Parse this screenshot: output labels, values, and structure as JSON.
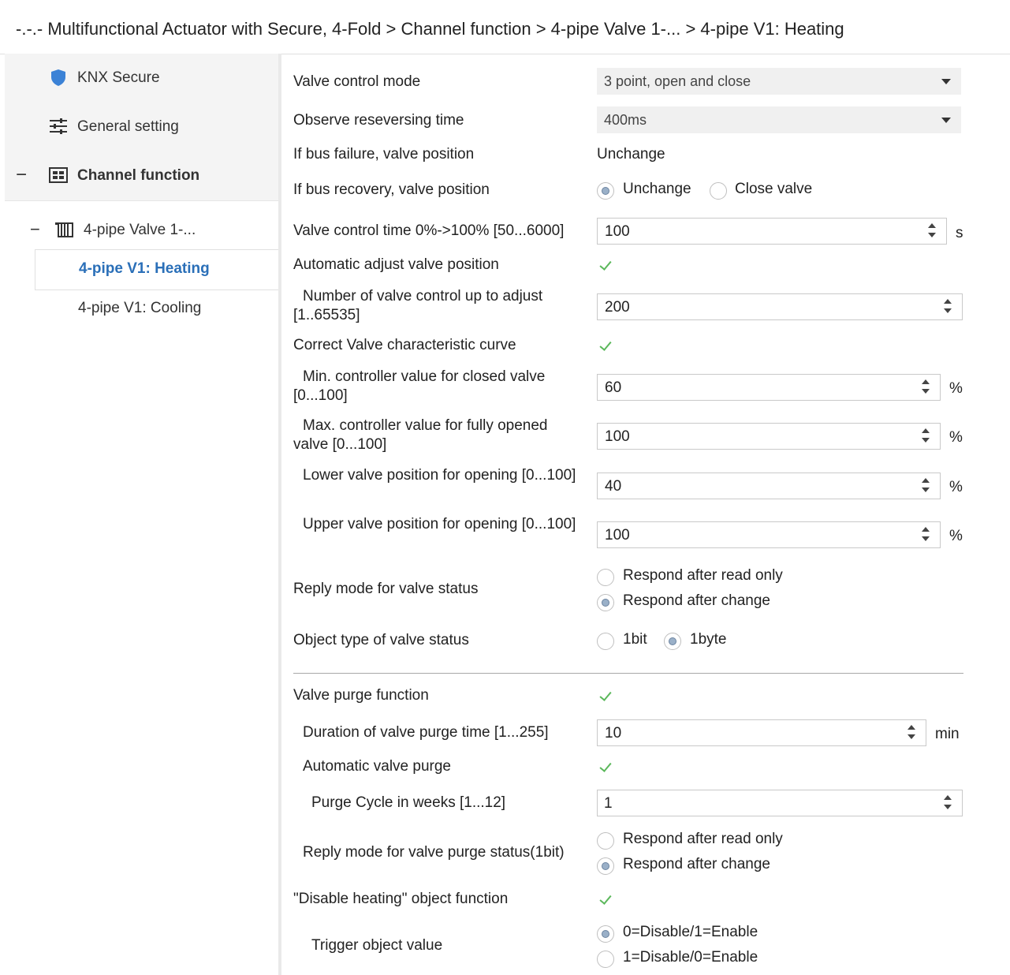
{
  "breadcrumb": "-.-.- Multifunctional Actuator with Secure, 4-Fold > Channel function > 4-pipe Valve 1-... > 4-pipe V1: Heating",
  "sidebar": {
    "items": [
      {
        "label": "KNX Secure",
        "icon": "shield-icon"
      },
      {
        "label": "General setting",
        "icon": "sliders-icon"
      },
      {
        "label": "Channel function",
        "icon": "grid-icon",
        "toggle": "−"
      },
      {
        "label": "4-pipe Valve 1-...",
        "icon": "radiator-icon",
        "toggle": "−"
      },
      {
        "label": "4-pipe V1: Heating",
        "active": true
      },
      {
        "label": "4-pipe V1: Cooling"
      }
    ]
  },
  "form": {
    "valve_control_mode": {
      "label": "Valve control mode",
      "value": "3 point, open and close"
    },
    "observe_time": {
      "label": "Observe reseversing time",
      "value": "400ms"
    },
    "bus_failure": {
      "label": "If bus failure, valve position",
      "value": "Unchange"
    },
    "bus_recovery": {
      "label": "If bus recovery, valve position",
      "options": [
        "Unchange",
        "Close valve"
      ],
      "selected": "Unchange"
    },
    "control_time": {
      "label": "Valve control time 0%->100% [50...6000]",
      "value": "100",
      "unit": "s"
    },
    "auto_adjust": {
      "label": "Automatic adjust valve position",
      "checked": true
    },
    "adjust_count": {
      "label": "Number of valve control up to adjust [1..65535]",
      "value": "200"
    },
    "correct_curve": {
      "label": "Correct Valve characteristic curve",
      "checked": true
    },
    "min_closed": {
      "label": "Min. controller value for closed valve [0...100]",
      "value": "60",
      "unit": "%"
    },
    "max_open": {
      "label": "Max. controller value for fully opened valve [0...100]",
      "value": "100",
      "unit": "%"
    },
    "lower_pos": {
      "label": "Lower valve position for opening [0...100]",
      "value": "40",
      "unit": "%"
    },
    "upper_pos": {
      "label": "Upper valve position for opening [0...100]",
      "value": "100",
      "unit": "%"
    },
    "reply_mode": {
      "label": "Reply mode for valve status",
      "options": [
        "Respond after read only",
        "Respond after change"
      ],
      "selected": "Respond after change"
    },
    "object_type": {
      "label": "Object type of valve status",
      "options": [
        "1bit",
        "1byte"
      ],
      "selected": "1byte"
    },
    "purge_func": {
      "label": "Valve purge function",
      "checked": true
    },
    "purge_duration": {
      "label": "Duration of valve purge time [1...255]",
      "value": "10",
      "unit": "min"
    },
    "auto_purge": {
      "label": "Automatic valve purge",
      "checked": true
    },
    "purge_cycle": {
      "label": "Purge Cycle in weeks [1...12]",
      "value": "1"
    },
    "purge_reply": {
      "label": "Reply mode for valve purge status(1bit)",
      "options": [
        "Respond after read only",
        "Respond after change"
      ],
      "selected": "Respond after change"
    },
    "disable_heating": {
      "label": "\"Disable heating\" object function",
      "checked": true
    },
    "trigger_value": {
      "label": "Trigger object value",
      "options": [
        "0=Disable/1=Enable",
        "1=Disable/0=Enable"
      ],
      "selected": "0=Disable/1=Enable"
    }
  }
}
